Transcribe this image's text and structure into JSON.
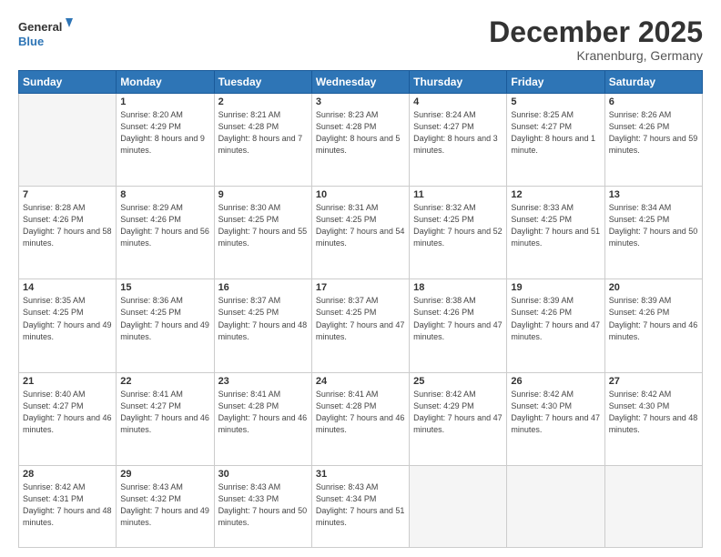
{
  "logo": {
    "line1": "General",
    "line2": "Blue"
  },
  "title": "December 2025",
  "location": "Kranenburg, Germany",
  "header_days": [
    "Sunday",
    "Monday",
    "Tuesday",
    "Wednesday",
    "Thursday",
    "Friday",
    "Saturday"
  ],
  "weeks": [
    [
      {
        "day": "",
        "sunrise": "",
        "sunset": "",
        "daylight": ""
      },
      {
        "day": "1",
        "sunrise": "Sunrise: 8:20 AM",
        "sunset": "Sunset: 4:29 PM",
        "daylight": "Daylight: 8 hours and 9 minutes."
      },
      {
        "day": "2",
        "sunrise": "Sunrise: 8:21 AM",
        "sunset": "Sunset: 4:28 PM",
        "daylight": "Daylight: 8 hours and 7 minutes."
      },
      {
        "day": "3",
        "sunrise": "Sunrise: 8:23 AM",
        "sunset": "Sunset: 4:28 PM",
        "daylight": "Daylight: 8 hours and 5 minutes."
      },
      {
        "day": "4",
        "sunrise": "Sunrise: 8:24 AM",
        "sunset": "Sunset: 4:27 PM",
        "daylight": "Daylight: 8 hours and 3 minutes."
      },
      {
        "day": "5",
        "sunrise": "Sunrise: 8:25 AM",
        "sunset": "Sunset: 4:27 PM",
        "daylight": "Daylight: 8 hours and 1 minute."
      },
      {
        "day": "6",
        "sunrise": "Sunrise: 8:26 AM",
        "sunset": "Sunset: 4:26 PM",
        "daylight": "Daylight: 7 hours and 59 minutes."
      }
    ],
    [
      {
        "day": "7",
        "sunrise": "Sunrise: 8:28 AM",
        "sunset": "Sunset: 4:26 PM",
        "daylight": "Daylight: 7 hours and 58 minutes."
      },
      {
        "day": "8",
        "sunrise": "Sunrise: 8:29 AM",
        "sunset": "Sunset: 4:26 PM",
        "daylight": "Daylight: 7 hours and 56 minutes."
      },
      {
        "day": "9",
        "sunrise": "Sunrise: 8:30 AM",
        "sunset": "Sunset: 4:25 PM",
        "daylight": "Daylight: 7 hours and 55 minutes."
      },
      {
        "day": "10",
        "sunrise": "Sunrise: 8:31 AM",
        "sunset": "Sunset: 4:25 PM",
        "daylight": "Daylight: 7 hours and 54 minutes."
      },
      {
        "day": "11",
        "sunrise": "Sunrise: 8:32 AM",
        "sunset": "Sunset: 4:25 PM",
        "daylight": "Daylight: 7 hours and 52 minutes."
      },
      {
        "day": "12",
        "sunrise": "Sunrise: 8:33 AM",
        "sunset": "Sunset: 4:25 PM",
        "daylight": "Daylight: 7 hours and 51 minutes."
      },
      {
        "day": "13",
        "sunrise": "Sunrise: 8:34 AM",
        "sunset": "Sunset: 4:25 PM",
        "daylight": "Daylight: 7 hours and 50 minutes."
      }
    ],
    [
      {
        "day": "14",
        "sunrise": "Sunrise: 8:35 AM",
        "sunset": "Sunset: 4:25 PM",
        "daylight": "Daylight: 7 hours and 49 minutes."
      },
      {
        "day": "15",
        "sunrise": "Sunrise: 8:36 AM",
        "sunset": "Sunset: 4:25 PM",
        "daylight": "Daylight: 7 hours and 49 minutes."
      },
      {
        "day": "16",
        "sunrise": "Sunrise: 8:37 AM",
        "sunset": "Sunset: 4:25 PM",
        "daylight": "Daylight: 7 hours and 48 minutes."
      },
      {
        "day": "17",
        "sunrise": "Sunrise: 8:37 AM",
        "sunset": "Sunset: 4:25 PM",
        "daylight": "Daylight: 7 hours and 47 minutes."
      },
      {
        "day": "18",
        "sunrise": "Sunrise: 8:38 AM",
        "sunset": "Sunset: 4:26 PM",
        "daylight": "Daylight: 7 hours and 47 minutes."
      },
      {
        "day": "19",
        "sunrise": "Sunrise: 8:39 AM",
        "sunset": "Sunset: 4:26 PM",
        "daylight": "Daylight: 7 hours and 47 minutes."
      },
      {
        "day": "20",
        "sunrise": "Sunrise: 8:39 AM",
        "sunset": "Sunset: 4:26 PM",
        "daylight": "Daylight: 7 hours and 46 minutes."
      }
    ],
    [
      {
        "day": "21",
        "sunrise": "Sunrise: 8:40 AM",
        "sunset": "Sunset: 4:27 PM",
        "daylight": "Daylight: 7 hours and 46 minutes."
      },
      {
        "day": "22",
        "sunrise": "Sunrise: 8:41 AM",
        "sunset": "Sunset: 4:27 PM",
        "daylight": "Daylight: 7 hours and 46 minutes."
      },
      {
        "day": "23",
        "sunrise": "Sunrise: 8:41 AM",
        "sunset": "Sunset: 4:28 PM",
        "daylight": "Daylight: 7 hours and 46 minutes."
      },
      {
        "day": "24",
        "sunrise": "Sunrise: 8:41 AM",
        "sunset": "Sunset: 4:28 PM",
        "daylight": "Daylight: 7 hours and 46 minutes."
      },
      {
        "day": "25",
        "sunrise": "Sunrise: 8:42 AM",
        "sunset": "Sunset: 4:29 PM",
        "daylight": "Daylight: 7 hours and 47 minutes."
      },
      {
        "day": "26",
        "sunrise": "Sunrise: 8:42 AM",
        "sunset": "Sunset: 4:30 PM",
        "daylight": "Daylight: 7 hours and 47 minutes."
      },
      {
        "day": "27",
        "sunrise": "Sunrise: 8:42 AM",
        "sunset": "Sunset: 4:30 PM",
        "daylight": "Daylight: 7 hours and 48 minutes."
      }
    ],
    [
      {
        "day": "28",
        "sunrise": "Sunrise: 8:42 AM",
        "sunset": "Sunset: 4:31 PM",
        "daylight": "Daylight: 7 hours and 48 minutes."
      },
      {
        "day": "29",
        "sunrise": "Sunrise: 8:43 AM",
        "sunset": "Sunset: 4:32 PM",
        "daylight": "Daylight: 7 hours and 49 minutes."
      },
      {
        "day": "30",
        "sunrise": "Sunrise: 8:43 AM",
        "sunset": "Sunset: 4:33 PM",
        "daylight": "Daylight: 7 hours and 50 minutes."
      },
      {
        "day": "31",
        "sunrise": "Sunrise: 8:43 AM",
        "sunset": "Sunset: 4:34 PM",
        "daylight": "Daylight: 7 hours and 51 minutes."
      },
      {
        "day": "",
        "sunrise": "",
        "sunset": "",
        "daylight": ""
      },
      {
        "day": "",
        "sunrise": "",
        "sunset": "",
        "daylight": ""
      },
      {
        "day": "",
        "sunrise": "",
        "sunset": "",
        "daylight": ""
      }
    ]
  ]
}
